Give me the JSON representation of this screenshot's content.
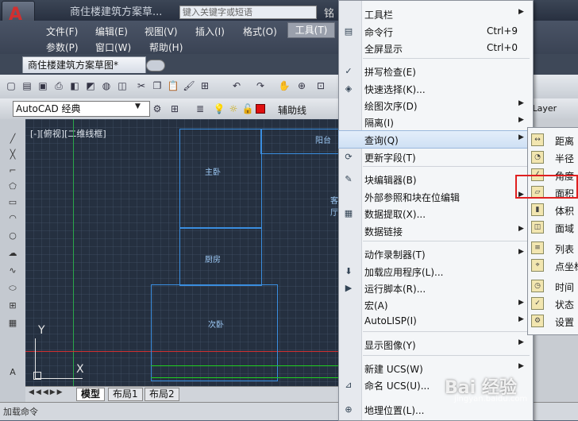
{
  "title_bar": {
    "title": "商住楼建筑方案草...",
    "search_placeholder": "键入关键字或短语",
    "title_fragment": "铭"
  },
  "menubar": {
    "row1": [
      "文件(F)",
      "编辑(E)",
      "视图(V)",
      "插入(I)",
      "格式(O)",
      "工具(T)"
    ],
    "row2": [
      "参数(P)",
      "窗口(W)",
      "帮助(H)"
    ]
  },
  "document_tab": {
    "label": "商住楼建筑方案草图*"
  },
  "toolbar": {
    "workspace": "AutoCAD 经典",
    "layer": "辅助线",
    "linetype": "yLayer"
  },
  "canvas": {
    "viewport_label": "[-][俯视][二维线框]",
    "rooms": [
      "主卧",
      "厨房",
      "次卧",
      "阳台",
      "客厅"
    ],
    "ucs_x": "X",
    "ucs_y": "Y"
  },
  "layout_tabs": [
    "模型",
    "布局1",
    "布局2"
  ],
  "command_line": "加载命令",
  "tools_menu": {
    "items": [
      {
        "label": "工具栏",
        "icon": "none",
        "arrow": true
      },
      {
        "label": "命令行",
        "shortcut": "Ctrl+9",
        "icon": "command-line-icon"
      },
      {
        "label": "全屏显示",
        "shortcut": "Ctrl+0",
        "icon": "none"
      },
      {
        "label": "拼写检查(E)",
        "icon": "spell-check-icon"
      },
      {
        "label": "快速选择(K)...",
        "icon": "quick-select-icon"
      },
      {
        "label": "绘图次序(D)",
        "icon": "none",
        "arrow": true
      },
      {
        "label": "隔离(I)",
        "icon": "none",
        "arrow": true
      },
      {
        "label": "查询(Q)",
        "icon": "none",
        "arrow": true,
        "highlighted": true
      },
      {
        "label": "更新字段(T)",
        "icon": "update-field-icon"
      },
      {
        "label": "块编辑器(B)",
        "icon": "block-editor-icon"
      },
      {
        "label": "外部参照和块在位编辑",
        "icon": "none",
        "arrow": true
      },
      {
        "label": "数据提取(X)...",
        "icon": "data-extract-icon"
      },
      {
        "label": "数据链接",
        "icon": "none",
        "arrow": true
      },
      {
        "label": "动作录制器(T)",
        "icon": "none",
        "arrow": true
      },
      {
        "label": "加载应用程序(L)...",
        "icon": "load-app-icon"
      },
      {
        "label": "运行脚本(R)...",
        "icon": "script-icon"
      },
      {
        "label": "宏(A)",
        "icon": "none",
        "arrow": true
      },
      {
        "label": "AutoLISP(I)",
        "icon": "none",
        "arrow": true
      },
      {
        "label": "显示图像(Y)",
        "icon": "none",
        "arrow": true
      },
      {
        "label": "新建 UCS(W)",
        "icon": "none",
        "arrow": true
      },
      {
        "label": "命名 UCS(U)...",
        "icon": "named-ucs-icon"
      },
      {
        "label": "地理位置(L)...",
        "icon": "geo-location-icon"
      }
    ]
  },
  "query_submenu": {
    "items": [
      "距离",
      "半径",
      "角度",
      "面积",
      "体积",
      "面域",
      "列表",
      "点坐标",
      "时间",
      "状态",
      "设置"
    ]
  },
  "watermark": {
    "text": "Bai 经验",
    "sub": "jingyan.baidu.com"
  }
}
